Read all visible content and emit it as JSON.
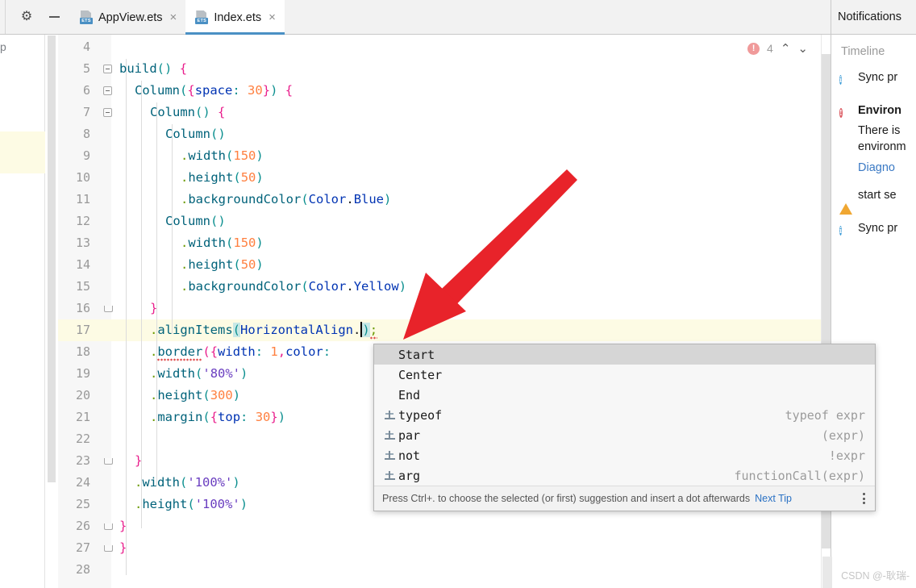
{
  "window": {
    "toolbar": {
      "gear_icon": "gear-icon",
      "minimize_icon": "minimize-icon",
      "overflow_icon": "kebab-menu-icon"
    },
    "tabs": [
      {
        "label": "AppView.ets",
        "icon": "ets-file-icon",
        "close": "×",
        "active": false
      },
      {
        "label": "Index.ets",
        "icon": "ets-file-icon",
        "close": "×",
        "active": true
      }
    ]
  },
  "left_strip": {
    "fragment_text": "p"
  },
  "editor": {
    "error_badge": {
      "count": "4",
      "icon": "error-circle-icon"
    },
    "nav_up": "⌃",
    "nav_down": "⌄",
    "lines": [
      {
        "num": "4",
        "fold": "",
        "code": ""
      },
      {
        "num": "5",
        "fold": "open",
        "code": "build"
      },
      {
        "num": "6",
        "fold": "open",
        "code": "Column({space: 30}) {"
      },
      {
        "num": "7",
        "fold": "open",
        "code": "Column() {"
      },
      {
        "num": "8",
        "fold": "",
        "code": "Column()"
      },
      {
        "num": "9",
        "fold": "",
        "code": ".width(150)"
      },
      {
        "num": "10",
        "fold": "",
        "code": ".height(50)"
      },
      {
        "num": "11",
        "fold": "",
        "code": ".backgroundColor(Color.Blue)"
      },
      {
        "num": "12",
        "fold": "",
        "code": "Column()"
      },
      {
        "num": "13",
        "fold": "",
        "code": ".width(150)"
      },
      {
        "num": "14",
        "fold": "",
        "code": ".height(50)"
      },
      {
        "num": "15",
        "fold": "",
        "code": ".backgroundColor(Color.Yellow)"
      },
      {
        "num": "16",
        "fold": "close",
        "code": "}"
      },
      {
        "num": "17",
        "fold": "",
        "code": ".alignItems(HorizontalAlign.);"
      },
      {
        "num": "18",
        "fold": "",
        "code": ".border({width: 1,color:"
      },
      {
        "num": "19",
        "fold": "",
        "code": ".width('80%')"
      },
      {
        "num": "20",
        "fold": "",
        "code": ".height(300)"
      },
      {
        "num": "21",
        "fold": "",
        "code": ".margin({top: 30})"
      },
      {
        "num": "22",
        "fold": "",
        "code": ""
      },
      {
        "num": "23",
        "fold": "close",
        "code": "}"
      },
      {
        "num": "24",
        "fold": "",
        "code": ".width('100%')"
      },
      {
        "num": "25",
        "fold": "",
        "code": ".height('100%')"
      },
      {
        "num": "26",
        "fold": "close",
        "code": "}"
      },
      {
        "num": "27",
        "fold": "close",
        "code": "}"
      },
      {
        "num": "28",
        "fold": "",
        "code": ""
      }
    ]
  },
  "autocomplete": {
    "items": [
      {
        "label": "Start",
        "hint": "",
        "icon": "",
        "selected": true
      },
      {
        "label": "Center",
        "hint": "",
        "icon": "",
        "selected": false
      },
      {
        "label": "End",
        "hint": "",
        "icon": "",
        "selected": false
      },
      {
        "label": "typeof",
        "hint": "typeof expr",
        "icon": "live-template-icon",
        "selected": false
      },
      {
        "label": "par",
        "hint": "(expr)",
        "icon": "live-template-icon",
        "selected": false
      },
      {
        "label": "not",
        "hint": "!expr",
        "icon": "live-template-icon",
        "selected": false
      },
      {
        "label": "arg",
        "hint": "functionCall(expr)",
        "icon": "live-template-icon",
        "selected": false
      }
    ],
    "footer_hint": "Press Ctrl+. to choose the selected (or first) suggestion and insert a dot afterwards",
    "footer_link": "Next Tip",
    "footer_menu_icon": "kebab-menu-icon"
  },
  "notifications": {
    "title": "Notifications",
    "section_label": "Timeline",
    "items": [
      {
        "severity": "info",
        "title": "Sync pr",
        "body": "",
        "link": ""
      },
      {
        "severity": "error",
        "title": "Environ",
        "body": "There is\nenvironm",
        "link": "Diagno"
      },
      {
        "severity": "warning",
        "title": "start se",
        "body": "",
        "link": ""
      },
      {
        "severity": "info",
        "title": "Sync pr",
        "body": "",
        "link": ""
      }
    ]
  },
  "watermark": {
    "text": "CSDN @-耿瑞-"
  },
  "colors": {
    "accent": "#4a90c4",
    "error": "#db5860",
    "warning": "#f0a732",
    "info": "#3c9bd6",
    "link": "#3a79c4",
    "annotation_arrow": "#e8232a",
    "highlight_line": "#fdfbe4"
  }
}
